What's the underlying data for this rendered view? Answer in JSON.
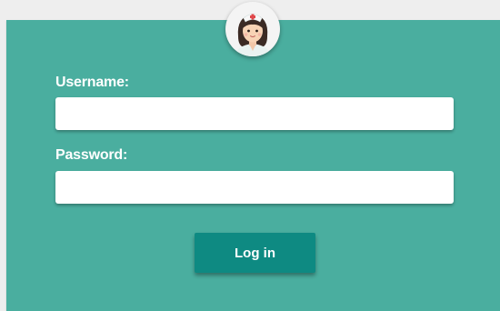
{
  "avatar": {
    "icon": "nurse-avatar-icon"
  },
  "form": {
    "username_label": "Username:",
    "username_value": "",
    "password_label": "Password:",
    "password_value": "",
    "login_label": "Log in"
  },
  "colors": {
    "background": "#eeeeee",
    "panel": "#4aae9f",
    "button": "#0e8a82",
    "input": "#ffffff",
    "text": "#ffffff"
  }
}
